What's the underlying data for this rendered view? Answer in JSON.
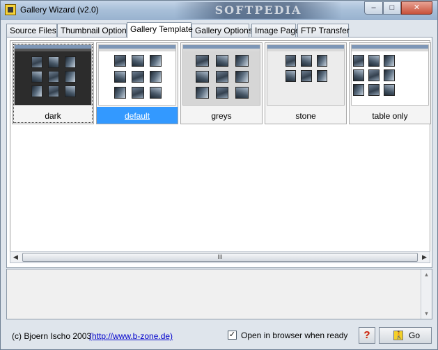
{
  "window": {
    "title": "Gallery Wizard (v2.0)",
    "watermark": "SOFTPEDIA",
    "minimize_glyph": "–",
    "maximize_glyph": "□",
    "close_glyph": "✕"
  },
  "tabs": [
    {
      "label": "Source Files"
    },
    {
      "label": "Thumbnail Options"
    },
    {
      "label": "Gallery Template",
      "active": true
    },
    {
      "label": "Gallery Options"
    },
    {
      "label": "Image Page"
    },
    {
      "label": "FTP Transfer"
    }
  ],
  "templates": [
    {
      "label": "dark",
      "background": "#2a2a2a",
      "focused": true
    },
    {
      "label": "default",
      "background": "#ffffff",
      "selected": true
    },
    {
      "label": "greys",
      "background": "#d8d8d8"
    },
    {
      "label": "stone",
      "background": "#ececec"
    },
    {
      "label": "table only",
      "background": "#ffffff"
    }
  ],
  "scrollbar": {
    "grip": "III",
    "left_arrow": "◀",
    "right_arrow": "▶",
    "up_arrow": "▲",
    "down_arrow": "▼"
  },
  "footer": {
    "copyright": "(c) Bjoern Ischo 2003",
    "homepage_link": "(http://www.b-zone.de)",
    "open_in_browser_label": "Open in browser when ready",
    "open_in_browser_checked": true,
    "check_glyph": "✓",
    "help_label": "?",
    "go_label": "Go",
    "go_icon": "walking-man-icon"
  }
}
